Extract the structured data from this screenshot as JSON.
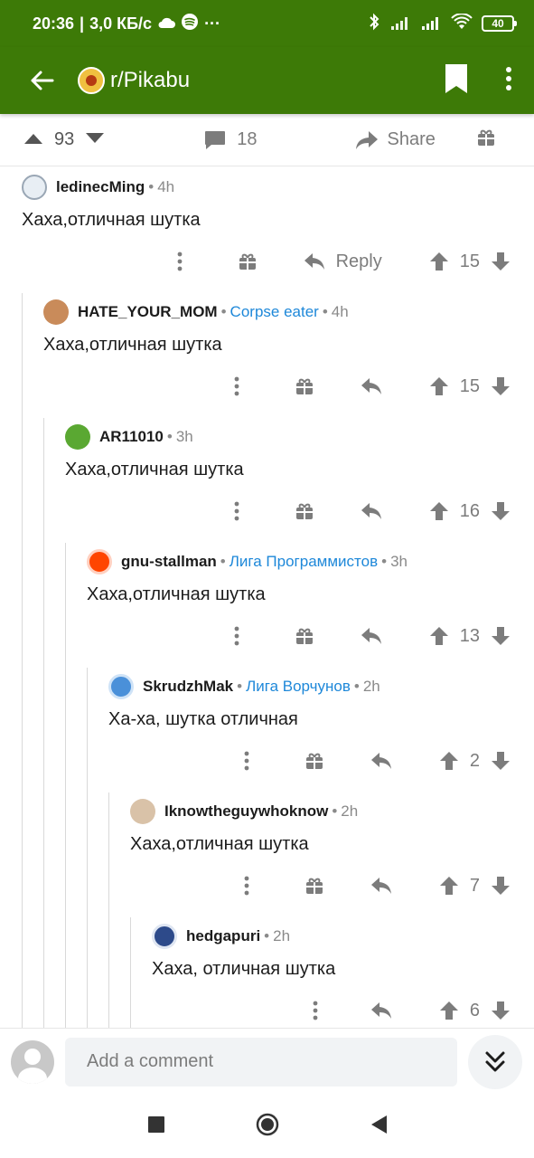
{
  "status_bar": {
    "time": "20:36",
    "network_speed": "3,0 КБ/с",
    "battery": "40"
  },
  "app_bar": {
    "title": "r/Pikabu"
  },
  "post_bar": {
    "score": "93",
    "comments": "18",
    "share_label": "Share"
  },
  "comments": [
    {
      "user": "ledinecMing",
      "flair": "",
      "time": "4h",
      "text": "Хаха,отличная шутка",
      "score": "15",
      "reply_label": "Reply",
      "avatar_color": "#e8eef4"
    },
    {
      "user": "HATE_YOUR_MOM",
      "flair": "Corpse eater",
      "time": "4h",
      "text": "Хаха,отличная шутка",
      "score": "15",
      "avatar_color": "#c98b5a"
    },
    {
      "user": "AR11010",
      "flair": "",
      "time": "3h",
      "text": "Хаха,отличная шутка",
      "score": "16",
      "avatar_color": "#5aa832"
    },
    {
      "user": "gnu-stallman",
      "flair": "Лига Программистов",
      "time": "3h",
      "text": "Хаха,отличная шутка",
      "score": "13",
      "avatar_color": "#ff4500"
    },
    {
      "user": "SkrudzhMak",
      "flair": "Лига Ворчунов",
      "time": "2h",
      "text": "Ха-ха, шутка отличная",
      "score": "2",
      "avatar_color": "#4a90d9"
    },
    {
      "user": "Iknowtheguywhoknow",
      "flair": "",
      "time": "2h",
      "text": "Хаха,отличная шутка",
      "score": "7",
      "avatar_color": "#d9c2a8"
    },
    {
      "user": "hedgapuri",
      "flair": "",
      "time": "2h",
      "text": "Хаха, отличная шутка",
      "score": "6",
      "avatar_color": "#2d4a8a"
    }
  ],
  "comment_bar": {
    "placeholder": "Add a comment"
  },
  "colors": {
    "brand": "#3d7a07",
    "flair": "#1e88d9",
    "icon_gray": "#7c7c7c"
  }
}
